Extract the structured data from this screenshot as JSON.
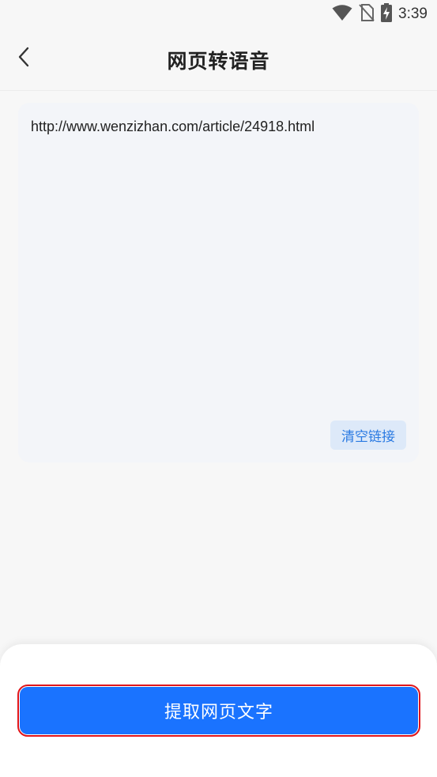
{
  "status_bar": {
    "time": "3:39",
    "icons": [
      "wifi-icon",
      "no-sim-icon",
      "battery-charging-icon"
    ]
  },
  "header": {
    "title": "网页转语音",
    "back_icon": "chevron-left-icon"
  },
  "url_input": {
    "value": "http://www.wenzizhan.com/article/24918.html",
    "clear_label": "清空链接"
  },
  "actions": {
    "extract_label": "提取网页文字"
  },
  "colors": {
    "primary": "#1a73ff",
    "link": "#2a7ae2",
    "highlight_border": "#e0141a"
  }
}
